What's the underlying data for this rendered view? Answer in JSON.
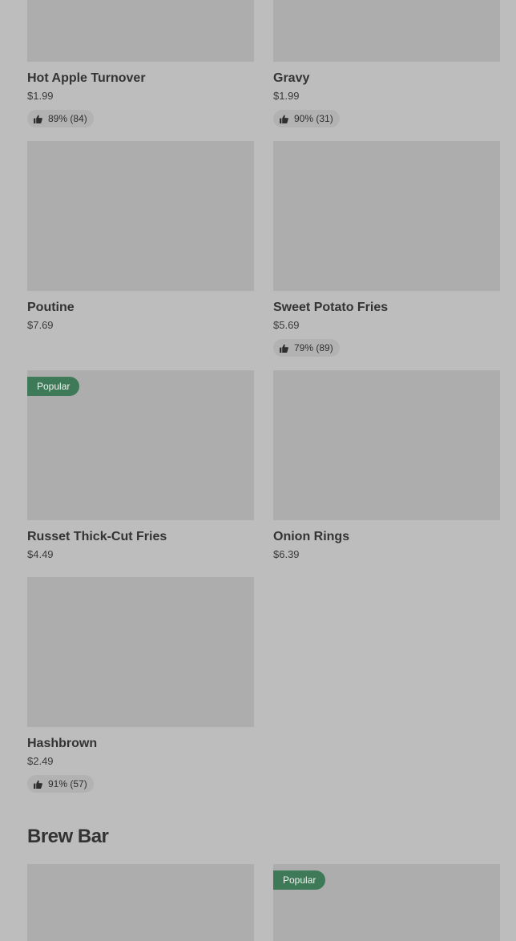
{
  "items": [
    {
      "name": "Hot Apple Turnover",
      "price": "$1.99",
      "rating": "89% (84)"
    },
    {
      "name": "Gravy",
      "price": "$1.99",
      "rating": "90% (31)"
    },
    {
      "name": "Poutine",
      "price": "$7.69"
    },
    {
      "name": "Sweet Potato Fries",
      "price": "$5.69",
      "rating": "79% (89)"
    },
    {
      "name": "Russet Thick-Cut Fries",
      "price": "$4.49",
      "badge": "Popular"
    },
    {
      "name": "Onion Rings",
      "price": "$6.39"
    },
    {
      "name": "Hashbrown",
      "price": "$2.49",
      "rating": "91% (57)"
    }
  ],
  "brew_bar": {
    "title": "Brew Bar",
    "items": [
      {},
      {
        "badge": "Popular"
      }
    ]
  },
  "icons": {
    "rating": "thumbs-up-icon"
  },
  "colors": {
    "badge": "#3e7a57",
    "background": "#bdbdbd",
    "image_placeholder": "#adadad"
  }
}
